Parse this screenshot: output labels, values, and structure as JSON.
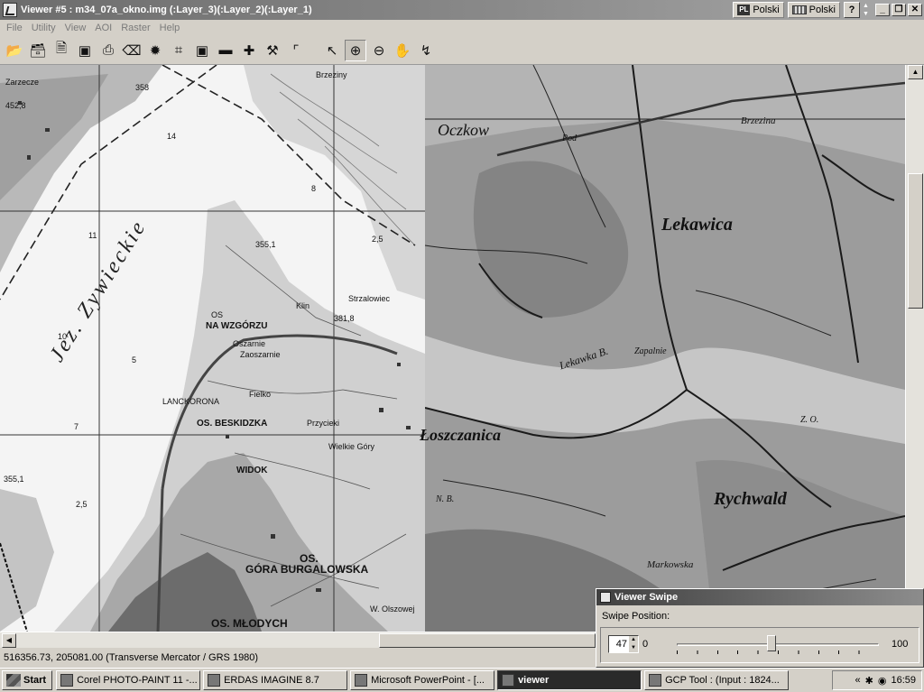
{
  "window": {
    "title": "Viewer #5 : m34_07a_okno.img (:Layer_3)(:Layer_2)(:Layer_1)",
    "lang_indicator": "PL",
    "lang_label_1": "Polski",
    "lang_label_2": "Polski",
    "help_label": "?",
    "minimize": "_",
    "restore": "❐",
    "close": "✕"
  },
  "menu": [
    "File",
    "Utility",
    "View",
    "AOI",
    "Raster",
    "Help"
  ],
  "toolbar": {
    "icons": [
      "open-folder-icon",
      "open-layer-icon",
      "new-icon",
      "save-icon",
      "print-icon",
      "eraser-icon",
      "layer-info-icon",
      "zoom-fit-icon",
      "zoom-extent-icon",
      "measure-icon",
      "crosshair-icon",
      "hammer-icon",
      "graph-icon",
      "arrow-select-icon",
      "zoom-in-icon",
      "zoom-out-icon",
      "pan-hand-icon",
      "inquire-icon"
    ],
    "pressed": "zoom-in-icon"
  },
  "map": {
    "lake_label": "Jez. Zywieckie",
    "topo_labels": {
      "zarzecze": "Zarzecze",
      "n452": "452,8",
      "n358": "358",
      "n14": "14",
      "brzeziny": "Brzeziny",
      "n8": "8",
      "n11": "11",
      "n3551": "355,1",
      "n25a": "2,5",
      "klin": "Klin",
      "strzalowiec": "Strzalowiec",
      "n3818": "381,8",
      "n10": "10",
      "n5": "5",
      "n7": "7",
      "na_wzgorzu": "NA WZGÓRZU",
      "os_top": "OS",
      "oszarnie": "Oszarnie",
      "zaoszarnie": "Zaoszarnie",
      "langkorona": "LANCKORONA",
      "fielko": "Fielko",
      "os_beskidzka": "OS. BESKIDZKA",
      "przycieki": "Przycieki",
      "wielkie_gony": "Wielkie Góry",
      "widok": "WIDOK",
      "n3551b": "355,1",
      "n25b": "2,5",
      "os_gora": "OS.",
      "gora_burgalowska": "GÓRA BURGALOWSKA",
      "os_mlodych": "OS. MŁODYCH",
      "w_olszowej": "W. Olszowej"
    },
    "old_labels": {
      "oczkow": "Oczkow",
      "lekawica": "Lekawica",
      "oszczanica": "Łoszczanica",
      "rychwald": "Rychwald",
      "lekawka": "Lekawka B.",
      "zapalnie": "Zapalnie",
      "markowska": "Markowska",
      "pod": "Pod",
      "brzezina": "Brzezina",
      "nad": "N. B.",
      "zo": "Z. O."
    }
  },
  "status": {
    "coords": "516356.73, 205081.00  (Transverse Mercator / GRS 1980)"
  },
  "swipe": {
    "title": "Viewer Swipe",
    "position_label": "Swipe Position:",
    "value": "47",
    "min": "0",
    "max": "100",
    "position_fraction": 0.47
  },
  "taskbar": {
    "start": "Start",
    "tasks": [
      "Corel PHOTO-PAINT 11 -...",
      "ERDAS IMAGINE 8.7",
      "Microsoft PowerPoint - [...",
      "viewer",
      "GCP Tool : (Input : 1824..."
    ],
    "active_task": 3,
    "time": "16:59"
  }
}
